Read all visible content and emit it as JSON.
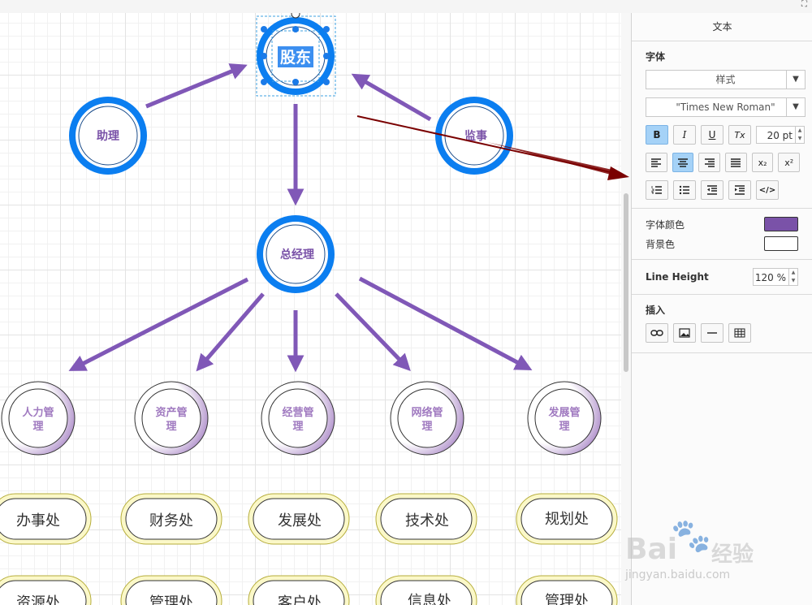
{
  "panel": {
    "title": "文本",
    "font_section": {
      "label": "字体",
      "style_select": "样式",
      "font_select": "\"Times New Roman\"",
      "bold_label": "B",
      "italic_label": "I",
      "underline_label": "U",
      "clear_label": "Tx",
      "size_value": "20 pt",
      "subscript_label": "x₂",
      "superscript_label": "x²",
      "html_label": "</>"
    },
    "colors": {
      "font_color_label": "字体颜色",
      "font_color": "#7a52a8",
      "bg_color_label": "背景色",
      "bg_color": "#ffffff"
    },
    "line_height": {
      "label": "Line Height",
      "value": "120 %"
    },
    "insert": {
      "label": "插入"
    }
  },
  "diagram": {
    "top_node": "股东",
    "left_node": "助理",
    "right_node": "监事",
    "center_node": "总经理",
    "departments": [
      "人力管理",
      "资产管理",
      "经营管理",
      "网络管理",
      "发展管理"
    ],
    "offices_row1": [
      "办事处",
      "财务处",
      "发展处",
      "技术处",
      "规划处"
    ],
    "offices_row2": [
      "资源处",
      "管理处",
      "客户处",
      "信息处",
      "管理处"
    ],
    "colors": {
      "blue_ring": "#0b7ef0",
      "arrow": "#8058b7",
      "label": "#7a52a8",
      "pointer": "#7a0000",
      "pill_border": "#e6e07a"
    }
  },
  "watermark": {
    "brand": "Bai",
    "brand2": "经验",
    "url": "jingyan.baidu.com"
  }
}
